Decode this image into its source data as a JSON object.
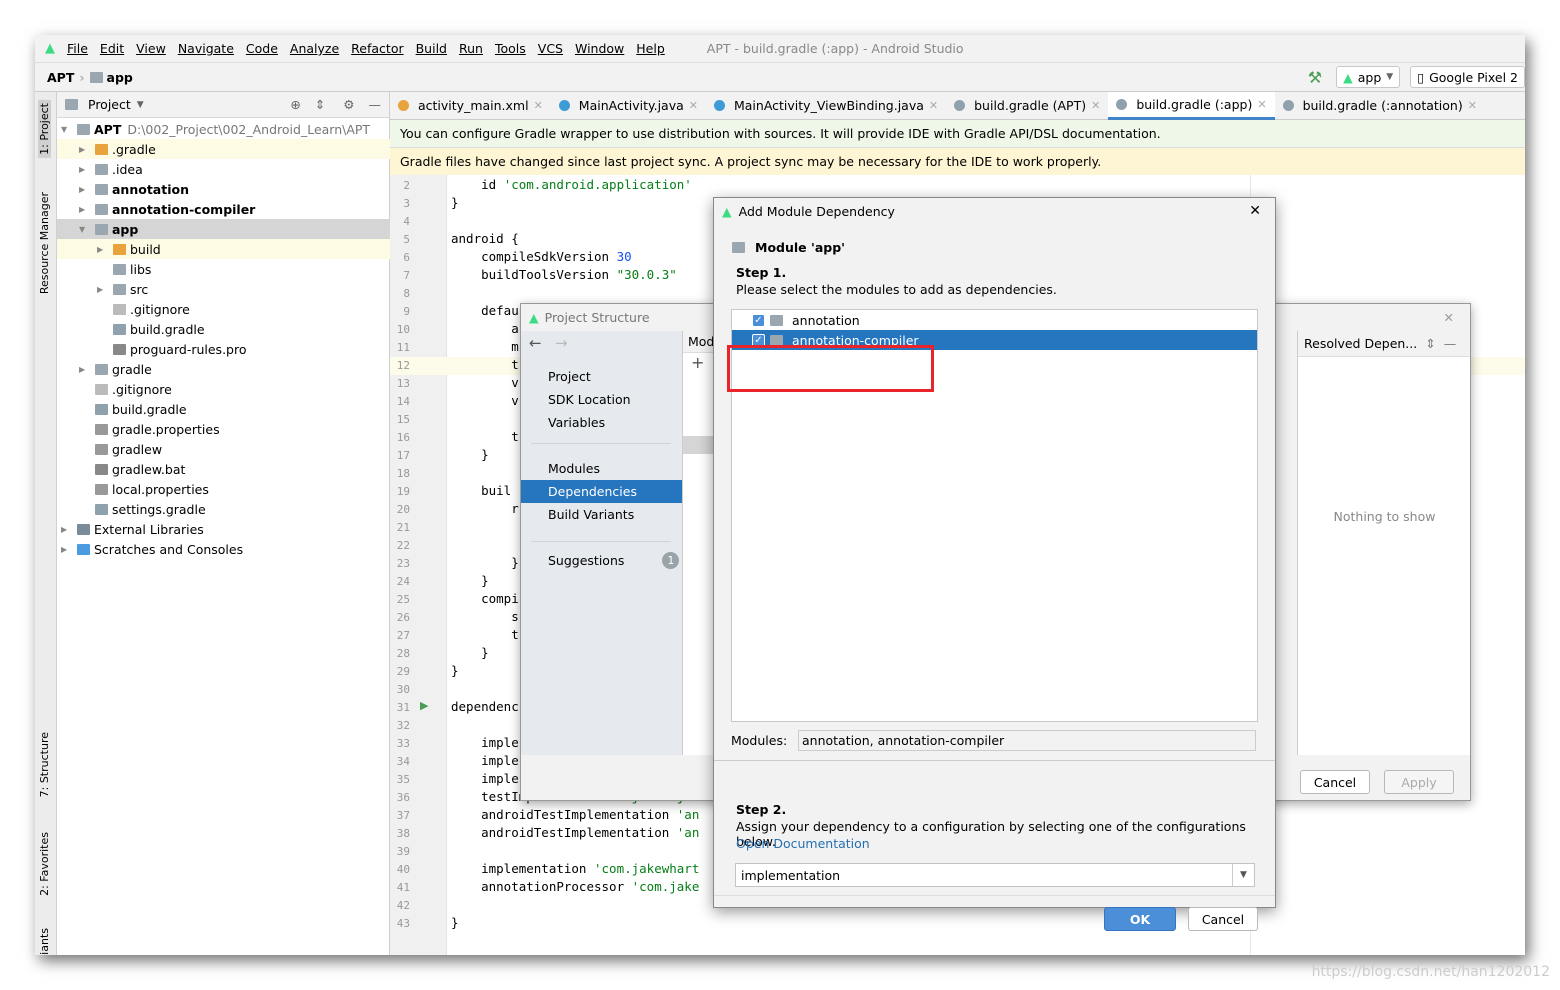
{
  "menu": [
    "File",
    "Edit",
    "View",
    "Navigate",
    "Code",
    "Analyze",
    "Refactor",
    "Build",
    "Run",
    "Tools",
    "VCS",
    "Window",
    "Help"
  ],
  "window_title": "APT - build.gradle (:app) - Android Studio",
  "breadcrumb": {
    "root": "APT",
    "module": "app"
  },
  "toolbar": {
    "run_config": "app",
    "device": "Google Pixel 2"
  },
  "left_strip": {
    "project": "1: Project",
    "resource_manager": "Resource Manager",
    "structure": "7: Structure",
    "favorites": "2: Favorites",
    "variants": "iants"
  },
  "project_panel": {
    "title": "Project",
    "tree": [
      {
        "label": "APT",
        "detail": "D:\\002_Project\\002_Android_Learn\\APT",
        "depth": 0,
        "bold": true,
        "arrow": "▼",
        "color": "#9aa7b0"
      },
      {
        "label": ".gradle",
        "depth": 1,
        "arrow": "▶",
        "color": "#e8a33d",
        "hl": true
      },
      {
        "label": ".idea",
        "depth": 1,
        "arrow": "▶",
        "color": "#9aa7b0"
      },
      {
        "label": "annotation",
        "depth": 1,
        "arrow": "▶",
        "color": "#9aa7b0",
        "bold": true
      },
      {
        "label": "annotation-compiler",
        "depth": 1,
        "arrow": "▶",
        "color": "#9aa7b0",
        "bold": true
      },
      {
        "label": "app",
        "depth": 1,
        "arrow": "▼",
        "color": "#9aa7b0",
        "bold": true,
        "sel": true
      },
      {
        "label": "build",
        "depth": 2,
        "arrow": "▶",
        "color": "#e8a33d",
        "hl": true
      },
      {
        "label": "libs",
        "depth": 2,
        "arrow": "",
        "color": "#9aa7b0"
      },
      {
        "label": "src",
        "depth": 2,
        "arrow": "▶",
        "color": "#9aa7b0"
      },
      {
        "label": ".gitignore",
        "depth": 2,
        "arrow": "",
        "color": "#bbb"
      },
      {
        "label": "build.gradle",
        "depth": 2,
        "arrow": "",
        "color": "#8fa1ad"
      },
      {
        "label": "proguard-rules.pro",
        "depth": 2,
        "arrow": "",
        "color": "#888"
      },
      {
        "label": "gradle",
        "depth": 1,
        "arrow": "▶",
        "color": "#9aa7b0"
      },
      {
        "label": ".gitignore",
        "depth": 1,
        "arrow": "",
        "color": "#bbb"
      },
      {
        "label": "build.gradle",
        "depth": 1,
        "arrow": "",
        "color": "#8fa1ad"
      },
      {
        "label": "gradle.properties",
        "depth": 1,
        "arrow": "",
        "color": "#999"
      },
      {
        "label": "gradlew",
        "depth": 1,
        "arrow": "",
        "color": "#999"
      },
      {
        "label": "gradlew.bat",
        "depth": 1,
        "arrow": "",
        "color": "#888"
      },
      {
        "label": "local.properties",
        "depth": 1,
        "arrow": "",
        "color": "#999"
      },
      {
        "label": "settings.gradle",
        "depth": 1,
        "arrow": "",
        "color": "#8fa1ad"
      },
      {
        "label": "External Libraries",
        "depth": 0,
        "arrow": "▶",
        "color": "#7a8b99"
      },
      {
        "label": "Scratches and Consoles",
        "depth": 0,
        "arrow": "▶",
        "color": "#4a9be0"
      }
    ]
  },
  "editor_tabs": [
    {
      "label": "activity_main.xml",
      "icon": "#e8a33d"
    },
    {
      "label": "MainActivity.java",
      "icon": "#3d9bd6"
    },
    {
      "label": "MainActivity_ViewBinding.java",
      "icon": "#3d9bd6"
    },
    {
      "label": "build.gradle (APT)",
      "icon": "#8fa1ad"
    },
    {
      "label": "build.gradle (:app)",
      "icon": "#8fa1ad",
      "active": true
    },
    {
      "label": "build.gradle (:annotation)",
      "icon": "#8fa1ad"
    }
  ],
  "banners": {
    "info": "You can configure Gradle wrapper to use distribution with sources. It will provide IDE with Gradle API/DSL documentation.",
    "warning": "Gradle files have changed since last project sync. A project sync may be necessary for the IDE to work properly."
  },
  "code_lines": [
    {
      "n": 2,
      "t": "    id ",
      "s": "'com.android.application'"
    },
    {
      "n": 3,
      "t": "}"
    },
    {
      "n": 4,
      "t": ""
    },
    {
      "n": 5,
      "t": "android {"
    },
    {
      "n": 6,
      "t": "    compileSdkVersion ",
      "num": "30"
    },
    {
      "n": 7,
      "t": "    buildToolsVersion ",
      "s": "\"30.0.3\""
    },
    {
      "n": 8,
      "t": ""
    },
    {
      "n": 9,
      "t": "    defau"
    },
    {
      "n": 10,
      "t": "        a"
    },
    {
      "n": 11,
      "t": "        m"
    },
    {
      "n": 12,
      "t": "        t"
    },
    {
      "n": 13,
      "t": "        v"
    },
    {
      "n": 14,
      "t": "        v"
    },
    {
      "n": 15,
      "t": ""
    },
    {
      "n": 16,
      "t": "        t"
    },
    {
      "n": 17,
      "t": "    }"
    },
    {
      "n": 18,
      "t": ""
    },
    {
      "n": 19,
      "t": "    buil"
    },
    {
      "n": 20,
      "t": "        r"
    },
    {
      "n": 21,
      "t": ""
    },
    {
      "n": 22,
      "t": ""
    },
    {
      "n": 23,
      "t": "        }"
    },
    {
      "n": 24,
      "t": "    }"
    },
    {
      "n": 25,
      "t": "    compi"
    },
    {
      "n": 26,
      "t": "        s"
    },
    {
      "n": 27,
      "t": "        t"
    },
    {
      "n": 28,
      "t": "    }"
    },
    {
      "n": 29,
      "t": "}"
    },
    {
      "n": 30,
      "t": ""
    },
    {
      "n": 31,
      "t": "dependenc"
    },
    {
      "n": 32,
      "t": ""
    },
    {
      "n": 33,
      "t": "    imple"
    },
    {
      "n": 34,
      "t": "    imple"
    },
    {
      "n": 35,
      "t": "    imple"
    },
    {
      "n": 36,
      "t": "    testImplementation ",
      "s": "'junit:ju"
    },
    {
      "n": 37,
      "t": "    androidTestImplementation ",
      "s": "'an"
    },
    {
      "n": 38,
      "t": "    androidTestImplementation ",
      "s": "'an"
    },
    {
      "n": 39,
      "t": ""
    },
    {
      "n": 40,
      "t": "    implementation ",
      "s": "'com.jakewhart"
    },
    {
      "n": 41,
      "t": "    annotationProcessor ",
      "s": "'com.jake"
    },
    {
      "n": 42,
      "t": ""
    },
    {
      "n": 43,
      "t": "}"
    }
  ],
  "project_structure": {
    "title": "Project Structure",
    "nav": [
      "Project",
      "SDK Location",
      "Variables",
      "Modules",
      "Dependencies",
      "Build Variants",
      "Suggestions"
    ],
    "selected": "Dependencies",
    "suggestions_count": "1",
    "modules_header": "Mod",
    "resolved_header": "Resolved Depen...",
    "empty_text": "Nothing to show",
    "cancel": "Cancel",
    "apply": "Apply"
  },
  "add_module_dependency": {
    "title": "Add Module Dependency",
    "module_label": "Module 'app'",
    "step1_title": "Step 1.",
    "step1_text": "Please select the modules to add as dependencies.",
    "modules": [
      {
        "label": "annotation",
        "checked": true
      },
      {
        "label": "annotation-compiler",
        "checked": true,
        "selected": true
      }
    ],
    "modules_field_label": "Modules:",
    "modules_field_value": "annotation, annotation-compiler",
    "step2_title": "Step 2.",
    "step2_text": "Assign your dependency to a configuration by selecting one of the configurations below.",
    "doc_link": "Open Documentation",
    "configuration": "implementation",
    "ok": "OK",
    "cancel": "Cancel"
  },
  "watermark": "https://blog.csdn.net/han1202012"
}
